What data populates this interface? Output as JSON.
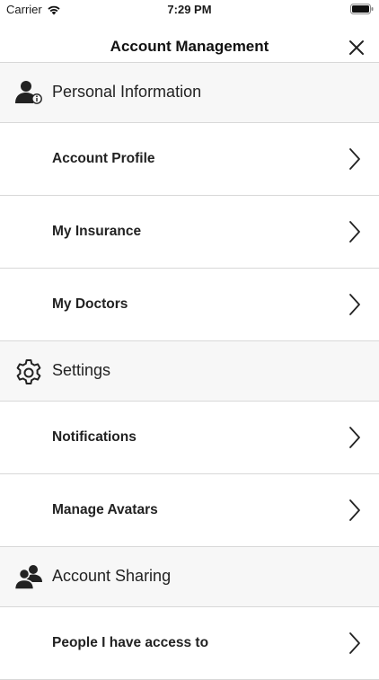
{
  "status": {
    "carrier": "Carrier",
    "time": "7:29 PM"
  },
  "nav": {
    "title": "Account Management"
  },
  "sections": [
    {
      "label": "Personal Information",
      "icon": "person-info-icon",
      "items": [
        {
          "label": "Account Profile"
        },
        {
          "label": "My Insurance"
        },
        {
          "label": "My Doctors"
        }
      ]
    },
    {
      "label": "Settings",
      "icon": "gear-icon",
      "items": [
        {
          "label": "Notifications"
        },
        {
          "label": "Manage Avatars"
        }
      ]
    },
    {
      "label": "Account Sharing",
      "icon": "people-icon",
      "items": [
        {
          "label": "People I have access to"
        }
      ]
    }
  ]
}
